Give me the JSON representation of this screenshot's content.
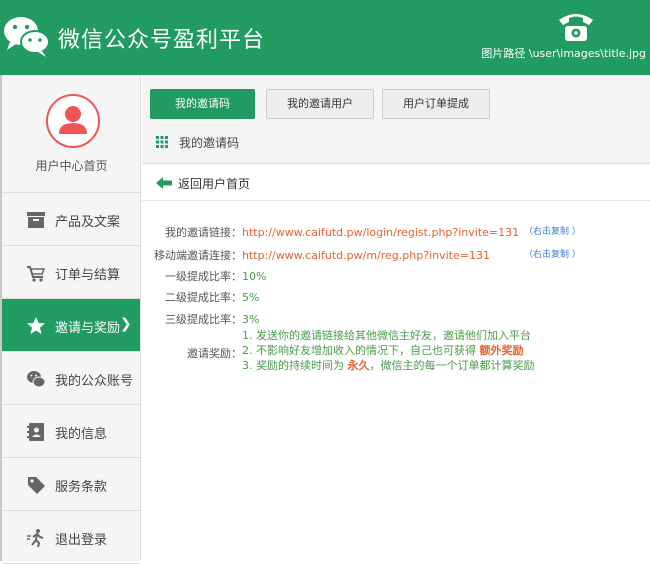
{
  "header": {
    "title": "微信公众号盈利平台",
    "image_path": "图片路径 \\user\\images\\title.jpg"
  },
  "sidebar": {
    "user_label": "用户中心首页",
    "items": [
      {
        "label": "产品及文案",
        "icon": "box-icon"
      },
      {
        "label": "订单与结算",
        "icon": "cart-icon"
      },
      {
        "label": "邀请与奖励",
        "icon": "star-icon",
        "active": true,
        "arrow": "❯"
      },
      {
        "label": "我的公众账号",
        "icon": "wechat-icon"
      },
      {
        "label": "我的信息",
        "icon": "contact-icon"
      },
      {
        "label": "服务条款",
        "icon": "tag-icon"
      },
      {
        "label": "退出登录",
        "icon": "exit-icon"
      }
    ]
  },
  "main": {
    "tabs": [
      {
        "label": "我的邀请码",
        "active": true
      },
      {
        "label": "我的邀请用户"
      },
      {
        "label": "用户订单提成"
      }
    ],
    "section_title": "我的邀请码",
    "back_label": "返回用户首页",
    "fields": [
      {
        "label": "我的邀请链接：",
        "value": "http://www.caifutd.pw/login/regist.php?invite=131",
        "copy": "（右击复制 ）"
      },
      {
        "label": "移动端邀请连接：",
        "value": "http://www.caifutd.pw/m/reg.php?invite=131",
        "copy": "（右击复制 ）"
      },
      {
        "label": "一级提成比率：",
        "value": "10%"
      },
      {
        "label": "二级提成比率：",
        "value": "5%"
      },
      {
        "label": "三级提成比率：",
        "value": "3%"
      }
    ],
    "reward": {
      "label": "邀请奖励：",
      "line1": "1. 发送你的邀请链接给其他微信主好友，邀请他们加入平台",
      "line2_a": "2. 不影响好友增加收入的情况下，自己也可获得 ",
      "line2_b": "额外奖励",
      "line3_a": "3. 奖励的持续时间为 ",
      "line3_b": "永久",
      "line3_c": "，微信主的每一个订单都计算奖励"
    }
  },
  "colors": {
    "brand_green": "#229b63",
    "link_orange": "#e8612c",
    "reward_green": "#4a9a4a",
    "copy_blue": "#3d7ad6"
  }
}
